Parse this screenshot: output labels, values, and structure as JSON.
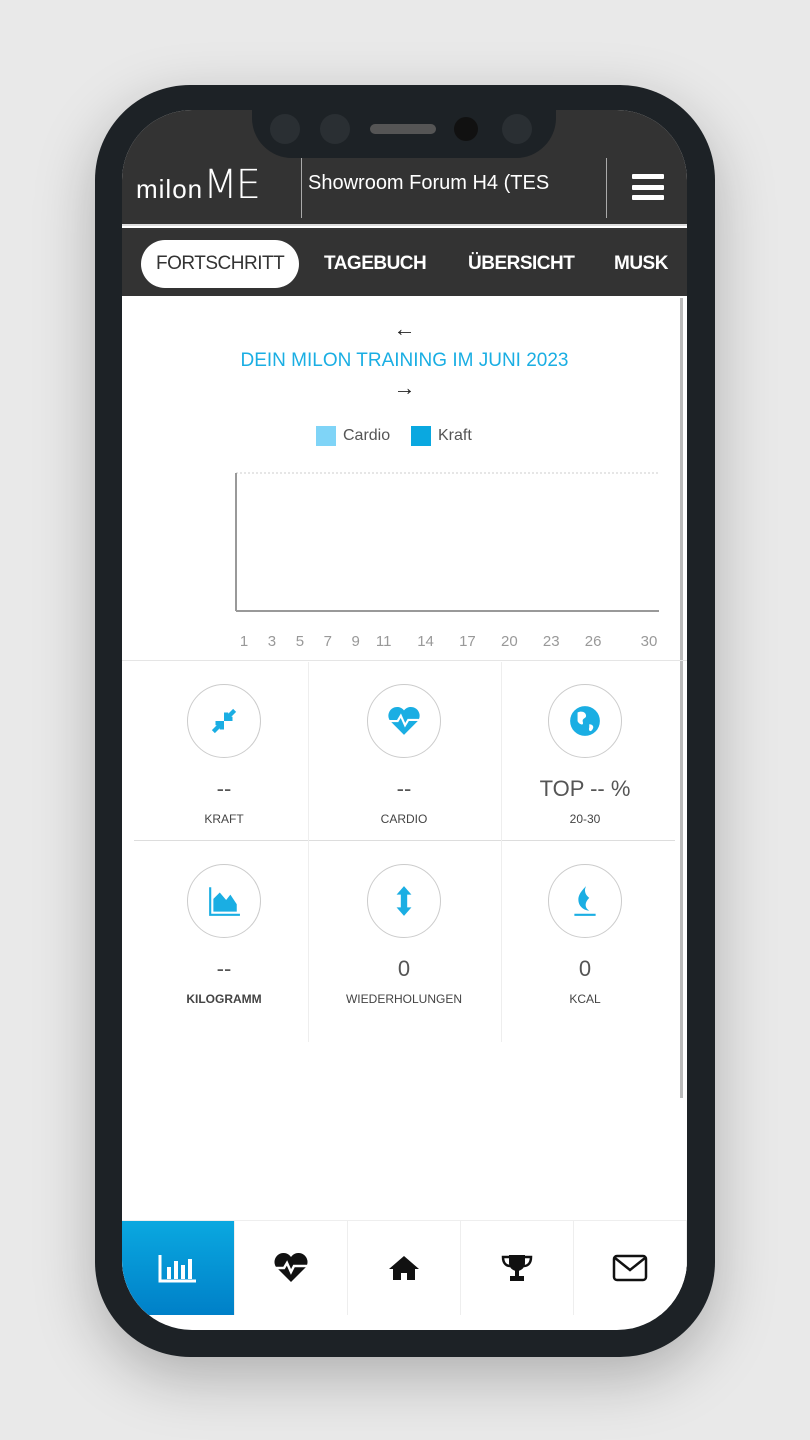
{
  "header": {
    "logo": "milonME",
    "logo_left": "milon",
    "logo_right": "ME",
    "title": "Showroom Forum H4 (TES"
  },
  "tabs": [
    {
      "label": "FORTSCHRITT",
      "active": true
    },
    {
      "label": "TAGEBUCH"
    },
    {
      "label": "ÜBERSICHT"
    },
    {
      "label": "MUSK"
    }
  ],
  "chart": {
    "prev": "←",
    "next": "→",
    "title": "DEIN MILON TRAINING IM JUNI 2023"
  },
  "chart_data": {
    "type": "bar",
    "title": "DEIN MILON TRAINING IM JUNI 2023",
    "x_ticks": [
      1,
      3,
      5,
      7,
      9,
      11,
      14,
      17,
      20,
      23,
      26,
      30
    ],
    "xlim": [
      1,
      30
    ],
    "series": [
      {
        "name": "Cardio",
        "color": "#7fd4f7",
        "values": []
      },
      {
        "name": "Kraft",
        "color": "#0aa8e0",
        "values": []
      }
    ],
    "legend": "top"
  },
  "stats": [
    {
      "icon": "compress-arrows-icon",
      "value": "--",
      "label": "KRAFT"
    },
    {
      "icon": "heartbeat-icon",
      "value": "--",
      "label": "CARDIO"
    },
    {
      "icon": "globe-icon",
      "value": "TOP -- %",
      "label": "20-30"
    },
    {
      "icon": "area-chart-icon",
      "value": "--",
      "label": "KILOGRAMM"
    },
    {
      "icon": "vertical-arrows-icon",
      "value": "0",
      "label": "WIEDERHOLUNGEN"
    },
    {
      "icon": "flame-icon",
      "value": "0",
      "label": "KCAL"
    }
  ],
  "nav": [
    "bar-chart-icon",
    "heartbeat-icon",
    "home-icon",
    "trophy-icon",
    "envelope-icon"
  ],
  "colors": {
    "accent": "#0aa8e0",
    "header": "#333333"
  }
}
